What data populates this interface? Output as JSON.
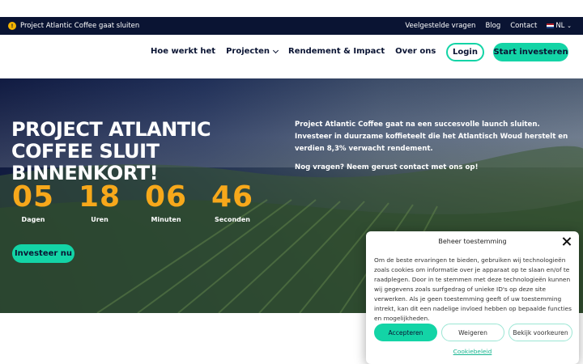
{
  "topbar": {
    "announcement": "Project Atlantic Coffee gaat sluiten",
    "links": [
      "Veelgestelde vragen",
      "Blog",
      "Contact"
    ],
    "language": "NL"
  },
  "nav": {
    "items": [
      "Hoe werkt het",
      "Projecten",
      "Rendement & Impact",
      "Over ons"
    ],
    "login": "Login",
    "cta": "Start investeren"
  },
  "hero": {
    "title": "Project Atlantic Coffee sluit binnenkort!",
    "countdown": [
      {
        "value": "05",
        "label": "Dagen"
      },
      {
        "value": "18",
        "label": "Uren"
      },
      {
        "value": "06",
        "label": "Minuten"
      },
      {
        "value": "46",
        "label": "Seconden"
      }
    ],
    "button": "Investeer nu",
    "text1": "Project Atlantic Coffee gaat na een succesvolle launch sluiten. Investeer in duurzame koffieteelt die het Atlantisch Woud herstelt en verdien 8,3% verwacht rendement.",
    "text2": "Nog vragen? Neem gerust contact met ons op!"
  },
  "cookie": {
    "title": "Beheer toestemming",
    "body": "Om de beste ervaringen te bieden, gebruiken wij technologieën zoals cookies om informatie over je apparaat op te slaan en/of te raadplegen. Door in te stemmen met deze technologieën kunnen wij gegevens zoals surfgedrag of unieke ID's op deze site verwerken. Als je geen toestemming geeft of uw toestemming intrekt, kan dit een nadelige invloed hebben op bepaalde functies en mogelijkheden.",
    "accept": "Accepteren",
    "deny": "Weigeren",
    "preferences": "Bekijk voorkeuren",
    "policy": "Cookiebeleid"
  },
  "colors": {
    "navy": "#0a1433",
    "accent": "#13d4a6",
    "countdown": "#f7a81b"
  }
}
